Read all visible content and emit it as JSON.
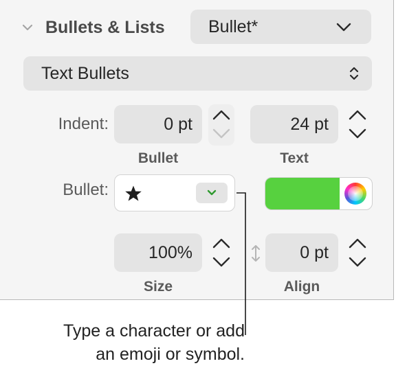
{
  "section": {
    "title": "Bullets & Lists",
    "expanded": true
  },
  "list_style_popup": {
    "value": "Bullet*"
  },
  "bullet_type_popup": {
    "value": "Text Bullets"
  },
  "indent": {
    "label": "Indent:",
    "bullet": {
      "value": "0 pt",
      "caption": "Bullet"
    },
    "text": {
      "value": "24 pt",
      "caption": "Text"
    }
  },
  "bullet": {
    "label": "Bullet:",
    "character": "★",
    "color": "#57d13f"
  },
  "size": {
    "value": "100%",
    "caption": "Size"
  },
  "align": {
    "value": "0 pt",
    "caption": "Align"
  },
  "callout": {
    "line1": "Type a character or add",
    "line2": "an emoji or symbol."
  }
}
